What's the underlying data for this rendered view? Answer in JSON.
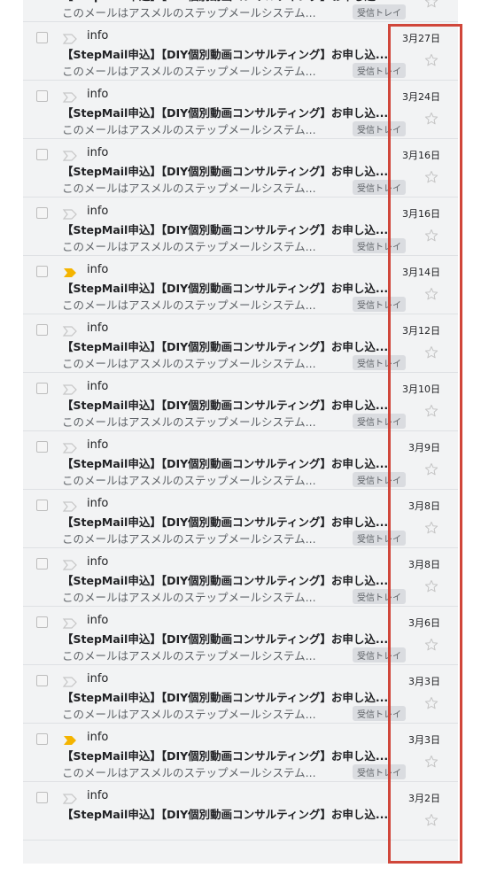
{
  "colors": {
    "highlight_border": "#d0463a",
    "important_marker_active": "#f4b400",
    "important_marker_inactive": "#c6c6c6",
    "label_background": "#dadce0"
  },
  "icons": {
    "checkbox": "checkbox-icon",
    "importance": "importance-marker-icon",
    "star": "star-outline-icon"
  },
  "emails": [
    {
      "sender": "",
      "date": "",
      "subject": "【StepMail申込】【DIY個別動画コンサルティング】お申し込...",
      "snippet": "このメールはアスメルのステップメールシステム...",
      "label": "受信トレイ",
      "important": false,
      "partial": "top"
    },
    {
      "sender": "info",
      "date": "3月27日",
      "subject": "【StepMail申込】【DIY個別動画コンサルティング】お申し込...",
      "snippet": "このメールはアスメルのステップメールシステム...",
      "label": "受信トレイ",
      "important": false
    },
    {
      "sender": "info",
      "date": "3月24日",
      "subject": "【StepMail申込】【DIY個別動画コンサルティング】お申し込...",
      "snippet": "このメールはアスメルのステップメールシステム...",
      "label": "受信トレイ",
      "important": false
    },
    {
      "sender": "info",
      "date": "3月16日",
      "subject": "【StepMail申込】【DIY個別動画コンサルティング】お申し込...",
      "snippet": "このメールはアスメルのステップメールシステム...",
      "label": "受信トレイ",
      "important": false
    },
    {
      "sender": "info",
      "date": "3月16日",
      "subject": "【StepMail申込】【DIY個別動画コンサルティング】お申し込...",
      "snippet": "このメールはアスメルのステップメールシステム...",
      "label": "受信トレイ",
      "important": false
    },
    {
      "sender": "info",
      "date": "3月14日",
      "subject": "【StepMail申込】【DIY個別動画コンサルティング】お申し込...",
      "snippet": "このメールはアスメルのステップメールシステム...",
      "label": "受信トレイ",
      "important": true
    },
    {
      "sender": "info",
      "date": "3月12日",
      "subject": "【StepMail申込】【DIY個別動画コンサルティング】お申し込...",
      "snippet": "このメールはアスメルのステップメールシステム...",
      "label": "受信トレイ",
      "important": false
    },
    {
      "sender": "info",
      "date": "3月10日",
      "subject": "【StepMail申込】【DIY個別動画コンサルティング】お申し込...",
      "snippet": "このメールはアスメルのステップメールシステム...",
      "label": "受信トレイ",
      "important": false
    },
    {
      "sender": "info",
      "date": "3月9日",
      "subject": "【StepMail申込】【DIY個別動画コンサルティング】お申し込...",
      "snippet": "このメールはアスメルのステップメールシステム...",
      "label": "受信トレイ",
      "important": false
    },
    {
      "sender": "info",
      "date": "3月8日",
      "subject": "【StepMail申込】【DIY個別動画コンサルティング】お申し込...",
      "snippet": "このメールはアスメルのステップメールシステム...",
      "label": "受信トレイ",
      "important": false
    },
    {
      "sender": "info",
      "date": "3月8日",
      "subject": "【StepMail申込】【DIY個別動画コンサルティング】お申し込...",
      "snippet": "このメールはアスメルのステップメールシステム...",
      "label": "受信トレイ",
      "important": false
    },
    {
      "sender": "info",
      "date": "3月6日",
      "subject": "【StepMail申込】【DIY個別動画コンサルティング】お申し込...",
      "snippet": "このメールはアスメルのステップメールシステム...",
      "label": "受信トレイ",
      "important": false
    },
    {
      "sender": "info",
      "date": "3月3日",
      "subject": "【StepMail申込】【DIY個別動画コンサルティング】お申し込...",
      "snippet": "このメールはアスメルのステップメールシステム...",
      "label": "受信トレイ",
      "important": false
    },
    {
      "sender": "info",
      "date": "3月3日",
      "subject": "【StepMail申込】【DIY個別動画コンサルティング】お申し込...",
      "snippet": "このメールはアスメルのステップメールシステム...",
      "label": "受信トレイ",
      "important": true
    },
    {
      "sender": "info",
      "date": "3月2日",
      "subject": "【StepMail申込】【DIY個別動画コンサルティング】お申し込...",
      "snippet": "",
      "label": "",
      "important": false,
      "partial": "bottom"
    }
  ]
}
